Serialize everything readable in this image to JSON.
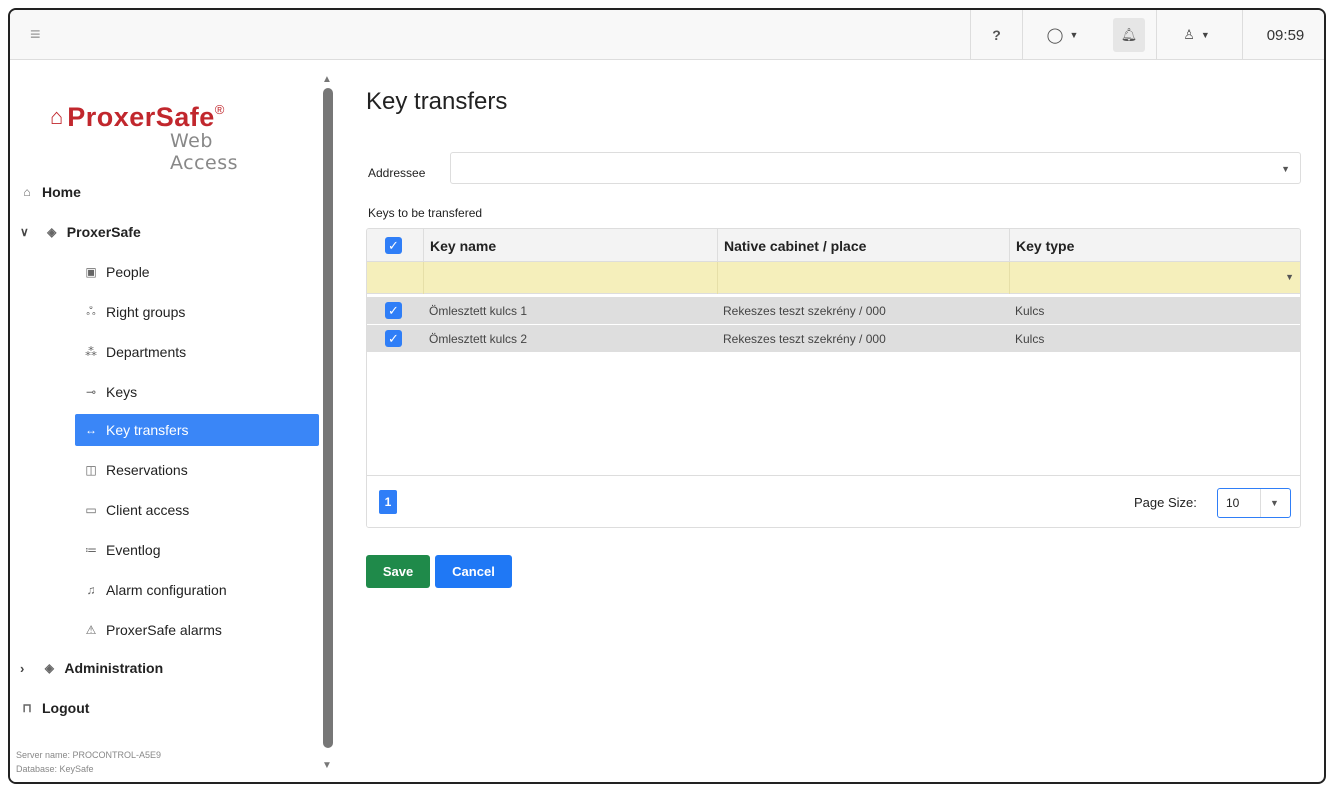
{
  "topbar": {
    "help_label": "?",
    "time": "09:59"
  },
  "sidebar": {
    "logo_main": "ProxerSafe",
    "logo_reg": "®",
    "logo_sub": "Web Access",
    "items": [
      {
        "label": "Home",
        "icon": "home-icon"
      },
      {
        "label": "ProxerSafe",
        "icon": "layers-icon"
      },
      {
        "label": "People",
        "icon": "id-card-icon"
      },
      {
        "label": "Right groups",
        "icon": "users-icon"
      },
      {
        "label": "Departments",
        "icon": "sitemap-icon"
      },
      {
        "label": "Keys",
        "icon": "key-icon"
      },
      {
        "label": "Key transfers",
        "icon": "arrows-h-icon"
      },
      {
        "label": "Reservations",
        "icon": "book-icon"
      },
      {
        "label": "Client access",
        "icon": "keyboard-icon"
      },
      {
        "label": "Eventlog",
        "icon": "list-icon"
      },
      {
        "label": "Alarm configuration",
        "icon": "bell-icon"
      },
      {
        "label": "ProxerSafe alarms",
        "icon": "warning-icon"
      },
      {
        "label": "Administration",
        "icon": "layers-icon"
      },
      {
        "label": "Logout",
        "icon": "door-icon"
      }
    ],
    "server_name": "Server name: PROCONTROL-A5E9",
    "database": "Database: KeySafe"
  },
  "main": {
    "title": "Key transfers",
    "addressee_label": "Addressee",
    "addressee_value": "",
    "keys_label": "Keys to be transfered",
    "columns": [
      "Key name",
      "Native cabinet / place",
      "Key type"
    ],
    "rows": [
      {
        "checked": true,
        "key_name": "Ömlesztett kulcs 1",
        "cabinet": "Rekeszes teszt szekrény / 000",
        "key_type": "Kulcs"
      },
      {
        "checked": true,
        "key_name": "Ömlesztett kulcs 2",
        "cabinet": "Rekeszes teszt szekrény / 000",
        "key_type": "Kulcs"
      }
    ],
    "current_page": "1",
    "page_size_label": "Page Size:",
    "page_size_value": "10",
    "save_label": "Save",
    "cancel_label": "Cancel"
  },
  "colors": {
    "accent": "#3a86f7",
    "save": "#1f8a4a",
    "filter_row": "#f5efbb",
    "brand": "#c1272d"
  }
}
